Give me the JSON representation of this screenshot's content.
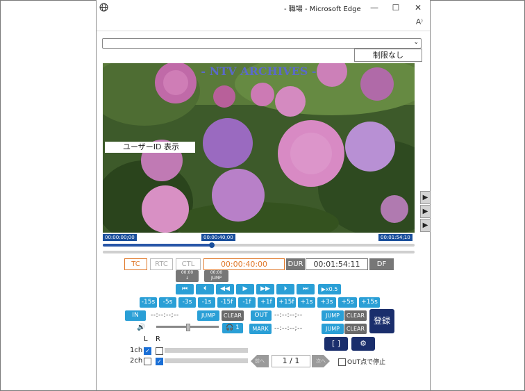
{
  "window": {
    "title": "- 職場 - Microsoft Edge",
    "minimize": "—",
    "maximize": "☐",
    "close": "✕",
    "reader_icon": "A⁾"
  },
  "toolbar": {
    "dropdown_value": "",
    "limit_label": "制限なし"
  },
  "video": {
    "watermark": "- NTV ARCHIVES -",
    "user_id_label": "ユーザーID 表示",
    "side_arrows": [
      "▶",
      "▶",
      "▶"
    ]
  },
  "timeline": {
    "start_tc": "00:00:00;00",
    "current_tc": "00:00:40;00",
    "end_tc": "00:01:54;10",
    "progress_fraction": 0.35
  },
  "modes": {
    "tc": "TC",
    "rtc": "RTC",
    "ctl": "CTL",
    "timecode": "00:00:40:00",
    "dur_label": "DUR",
    "dur_value": "00:01:54:11",
    "df": "DF"
  },
  "gray_buttons": {
    "a_line1": "00:00",
    "a_line2": "↓",
    "b_line1": "00:00",
    "b_line2": "JUMP"
  },
  "transport": [
    "⏮",
    "⏴",
    "◀◀",
    "▶",
    "▶▶",
    "⏵",
    "⏭",
    "▶x0.5"
  ],
  "steps": [
    "-15s",
    "-5s",
    "-3s",
    "-1s",
    "-15f",
    "-1f",
    "+1f",
    "+15f",
    "+1s",
    "+3s",
    "+5s",
    "+15s"
  ],
  "in_row": {
    "in": "IN",
    "tc": "--:--:--;--",
    "jump": "JUMP",
    "clear": "CLEAR"
  },
  "out_row": {
    "out": "OUT",
    "tc": "--:--:--;--",
    "jump": "JUMP",
    "clear": "CLEAR"
  },
  "mark_row": {
    "mark": "MARK",
    "tc": "--:--:--;--",
    "jump": "JUMP",
    "clear": "CLEAR"
  },
  "audio": {
    "volume_icon": "🔊",
    "headphone_label": "🎧 1",
    "volume_fraction": 0.5,
    "l_label": "L",
    "r_label": "R",
    "ch1": "1ch",
    "ch2": "2ch"
  },
  "register_label": "登録",
  "fullscreen_icon": "[ ]",
  "settings_icon": "⚙",
  "pager": {
    "prev": "前へ",
    "next": "次へ",
    "page": "1 / 1"
  },
  "out_stop_label": "OUT点で停止"
}
